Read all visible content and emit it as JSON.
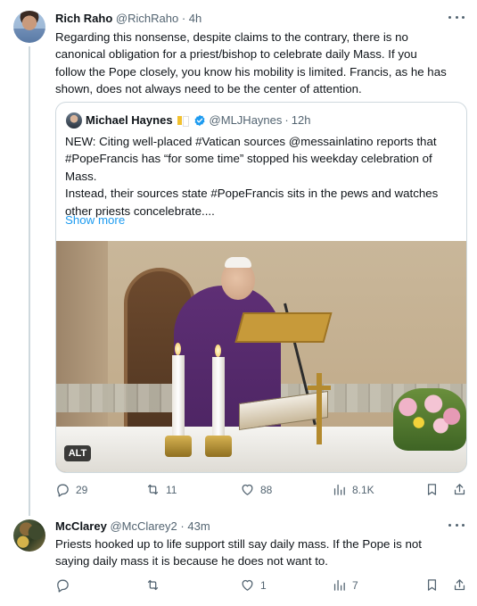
{
  "tweet1": {
    "name": "Rich Raho",
    "handle": "@RichRaho",
    "separator": "·",
    "time": "4h",
    "text_lines": [
      "Regarding this nonsense, despite claims to the contrary, there is no",
      "canonical obligation for a priest/bishop to celebrate daily Mass. If you",
      "follow the Pope closely, you know his mobility is limited. Francis, as he has",
      "shown, does not always need to be the center of attention."
    ],
    "quote": {
      "name": "Michael Haynes",
      "handle": "@MLJHaynes",
      "separator": "·",
      "time": "12h",
      "text_lines": [
        "NEW: Citing well-placed #Vatican sources @messainlatino reports that",
        "#PopeFrancis has “for some time” stopped his weekday celebration of",
        "Mass.",
        "Instead, their sources state #PopeFrancis sits in the pews and watches",
        "other priests concelebrate...."
      ],
      "show_more": "Show more",
      "image_alt_badge": "ALT"
    },
    "actions": {
      "replies": "29",
      "retweets": "11",
      "likes": "88",
      "views": "8.1K"
    }
  },
  "tweet2": {
    "name": "McClarey",
    "handle": "@McClarey2",
    "separator": "·",
    "time": "43m",
    "text_lines": [
      "Priests hooked up to life support still say daily mass.  If the Pope is not",
      "saying daily mass it is because he does not want to."
    ],
    "actions": {
      "replies": "",
      "retweets": "",
      "likes": "1",
      "views": "7"
    }
  },
  "icons": [
    "more-icon",
    "reply-icon",
    "retweet-icon",
    "like-icon",
    "views-icon",
    "bookmark-icon",
    "share-icon",
    "verified-icon",
    "flag-icon"
  ],
  "colors": {
    "accent": "#1d9bf0",
    "secondary_text": "#536471",
    "border": "#cfd9de"
  }
}
